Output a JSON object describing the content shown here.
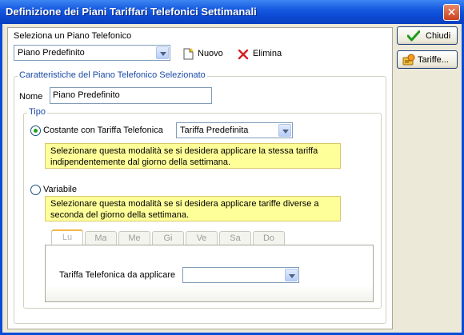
{
  "window": {
    "title": "Definizione dei Piani Tariffari Telefonici Settimanali",
    "close_symbol": "✕"
  },
  "plan": {
    "select_label": "Seleziona un Piano Telefonico",
    "selected": "Piano Predefinito",
    "new_label": "Nuovo",
    "delete_label": "Elimina"
  },
  "details": {
    "group_title": "Caratteristiche del Piano Telefonico Selezionato",
    "name_label": "Nome",
    "name_value": "Piano Predefinito",
    "type_title": "Tipo",
    "constant": {
      "label": "Costante con Tariffa Telefonica",
      "selected_tariff": "Tariffa Predefinita",
      "hint": "Selezionare questa modalità se si desidera applicare la stessa tariffa indipendentemente dal giorno della settimana.",
      "checked": true
    },
    "variable": {
      "label": "Variabile",
      "hint": "Selezionare questa modalità se si desidera applicare tariffe diverse a seconda del giorno della settimana.",
      "checked": false,
      "days": [
        "Lu",
        "Ma",
        "Me",
        "Gi",
        "Ve",
        "Sa",
        "Do"
      ],
      "tariff_label": "Tariffa Telefonica da applicare",
      "tariff_value": ""
    }
  },
  "buttons": {
    "close_label": "Chiudi",
    "tariffs_label": "Tariffe..."
  },
  "colors": {
    "titlebar": "#0a4bd8",
    "hint_bg": "#ffff99",
    "group_title": "#1a4aa8",
    "active_tab_accent": "#f0b54b"
  }
}
